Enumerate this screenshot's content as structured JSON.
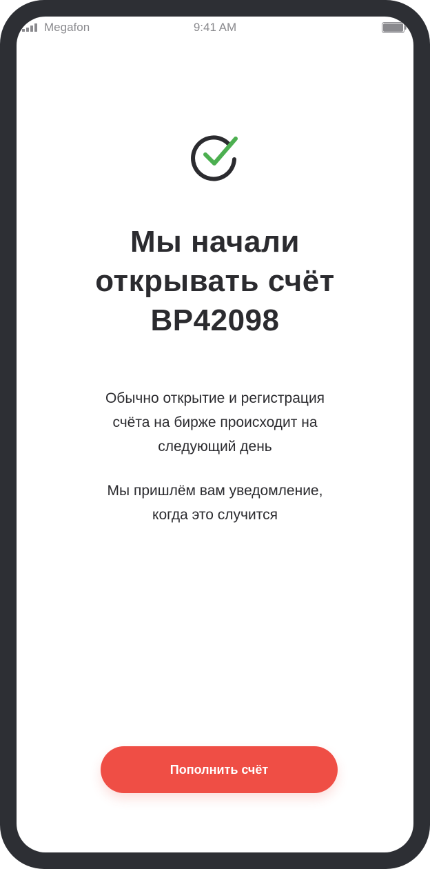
{
  "status_bar": {
    "carrier": "Megafon",
    "time": "9:41 AM",
    "signal_icon": "signal-bars-icon",
    "battery_icon": "battery-icon"
  },
  "success_icon": "check-circle-icon",
  "title_lines": [
    "Мы начали",
    "открывать счёт",
    "BP42098"
  ],
  "description_1_lines": [
    "Обычно открытие и регистрация",
    "счёта на бирже происходит на",
    "следующий день"
  ],
  "description_2_lines": [
    "Мы пришлём вам уведомление,",
    "когда это случится"
  ],
  "cta": {
    "label": "Пополнить счёт"
  },
  "colors": {
    "accent": "#ef4e45",
    "check": "#4caf50",
    "text": "#2b2b2f",
    "frame": "#2d2f34"
  }
}
